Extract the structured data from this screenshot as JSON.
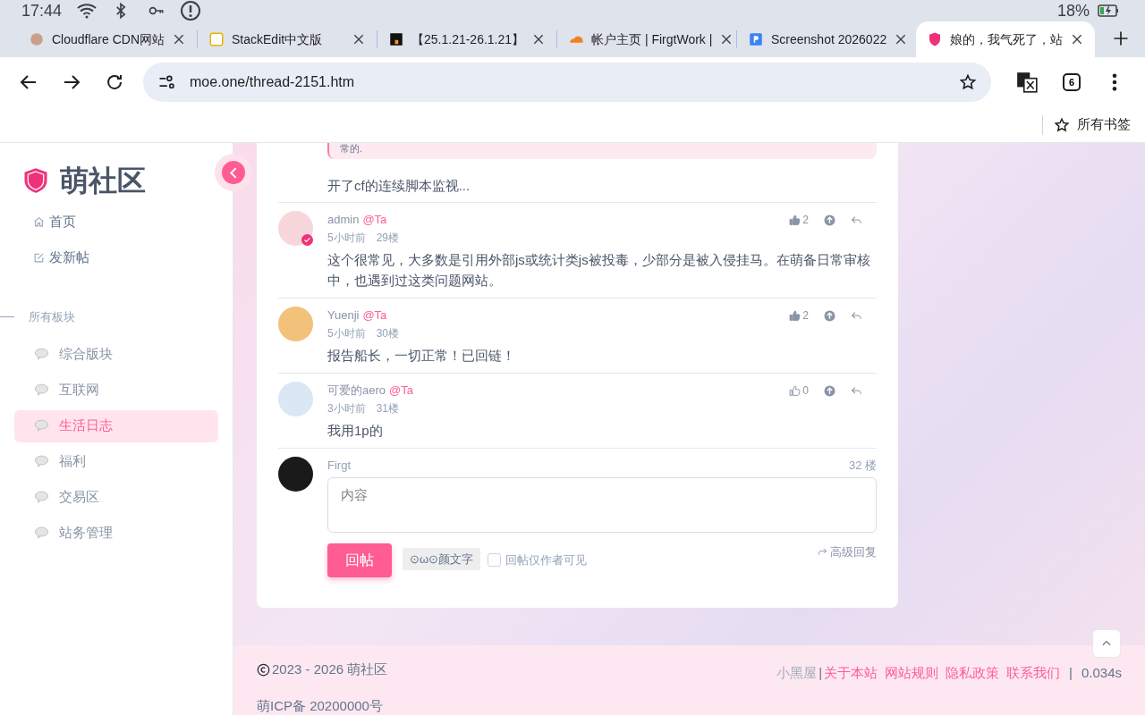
{
  "status_bar": {
    "time": "17:44",
    "battery": "18%"
  },
  "tabs": [
    {
      "title": "Cloudflare CDN网站",
      "selected": false
    },
    {
      "title": "StackEdit中文版",
      "selected": false
    },
    {
      "title": "【25.1.21-26.1.21】",
      "selected": false
    },
    {
      "title": "帐户主页 | FirgtWork |",
      "selected": false
    },
    {
      "title": "Screenshot 2026022",
      "selected": false
    },
    {
      "title": "娘的，我气死了，站",
      "selected": true
    }
  ],
  "address_bar": {
    "url": "moe.one/thread-2151.htm",
    "tab_count": "6"
  },
  "bookmarks_bar": {
    "label": "所有书签"
  },
  "sidebar": {
    "site_name": "萌社区",
    "nav": [
      {
        "label": "首页",
        "kind": "home"
      },
      {
        "label": "发新帖",
        "kind": "compose"
      }
    ],
    "section_label": "所有板块",
    "forums": [
      {
        "label": "综合版块",
        "selected": false
      },
      {
        "label": "互联网",
        "selected": false
      },
      {
        "label": "生活日志",
        "selected": true
      },
      {
        "label": "福利",
        "selected": false
      },
      {
        "label": "交易区",
        "selected": false
      },
      {
        "label": "站务管理",
        "selected": false
      }
    ]
  },
  "thread": {
    "quote_tail": "常的.",
    "post_text": "开了cf的连续脚本监视...",
    "replies": [
      {
        "author": "admin",
        "mention": "@Ta",
        "time": "5小时前",
        "floor": "29楼",
        "likes": "2",
        "liked": true,
        "verified": true,
        "body": "这个很常见，大多数是引用外部js或统计类js被投毒，少部分是被入侵挂马。在萌备日常审核中，也遇到过这类问题网站。"
      },
      {
        "author": "Yuenji",
        "mention": "@Ta",
        "time": "5小时前",
        "floor": "30楼",
        "likes": "2",
        "liked": true,
        "verified": false,
        "body": "报告船长，一切正常！已回链！"
      },
      {
        "author": "可爱的aero",
        "mention": "@Ta",
        "time": "3小时前",
        "floor": "31楼",
        "likes": "0",
        "liked": false,
        "verified": false,
        "body": "我用1p的"
      }
    ],
    "reply_form": {
      "user": "Firgt",
      "floor": "32 楼",
      "placeholder": "内容",
      "submit": "回帖",
      "emoticon_button": "⊙ω⊙颜文字",
      "author_only": {
        "label": "回帖仅作者可见",
        "checked": false
      },
      "advanced": "高级回复"
    }
  },
  "footer": {
    "copyright": "2023 - 2026 萌社区",
    "blackroom": "小黑屋",
    "separator": "|",
    "links": [
      "关于本站",
      "网站规则",
      "隐私政策",
      "联系我们"
    ],
    "separator_2": "|",
    "render_time": "0.034s",
    "icp": "萌ICP备 20200000号"
  }
}
